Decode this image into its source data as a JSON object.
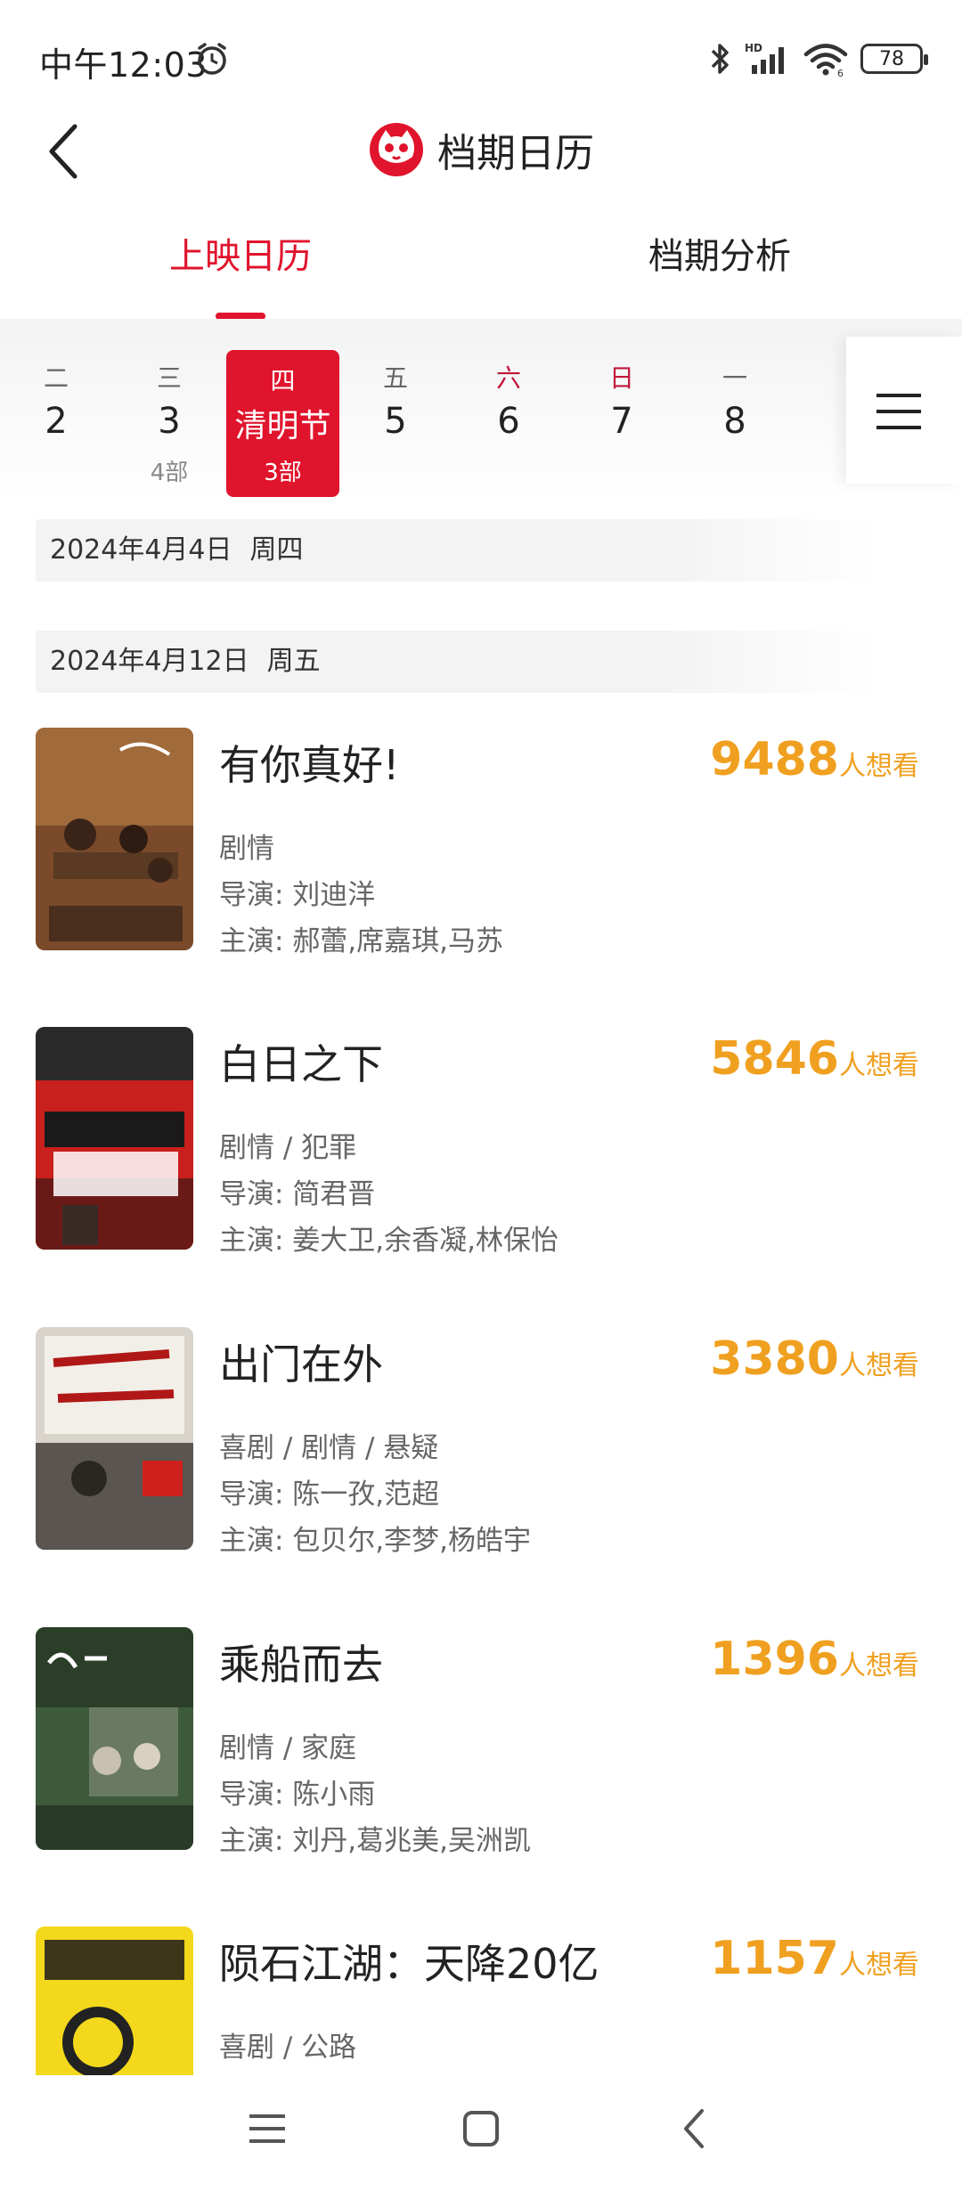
{
  "status_bar": {
    "time": "中午12:03",
    "battery": "78"
  },
  "header": {
    "title": "档期日历"
  },
  "tabs": [
    {
      "label": "上映日历",
      "active": true
    },
    {
      "label": "档期分析",
      "active": false
    }
  ],
  "date_strip": {
    "days": [
      {
        "weekday": "二",
        "day": "2",
        "count": "",
        "weekend": false
      },
      {
        "weekday": "三",
        "day": "3",
        "count": "4部",
        "weekend": false
      },
      {
        "weekday": "四",
        "day": "清明节",
        "count": "3部",
        "weekend": false,
        "selected": true
      },
      {
        "weekday": "五",
        "day": "5",
        "count": "",
        "weekend": false
      },
      {
        "weekday": "六",
        "day": "6",
        "count": "",
        "weekend": true
      },
      {
        "weekday": "日",
        "day": "7",
        "count": "",
        "weekend": true
      },
      {
        "weekday": "一",
        "day": "8",
        "count": "",
        "weekend": false
      }
    ]
  },
  "sections": [
    {
      "date": "2024年4月4日",
      "weekday": "周四"
    },
    {
      "date": "2024年4月12日",
      "weekday": "周五"
    }
  ],
  "movies": [
    {
      "title": "有你真好!",
      "want_count": "9488",
      "want_label": "人想看",
      "genre": "剧情",
      "director": "导演: 刘迪洋",
      "cast": "主演: 郝蕾,席嘉琪,马苏",
      "poster_color": "#7a4a2a"
    },
    {
      "title": "白日之下",
      "want_count": "5846",
      "want_label": "人想看",
      "genre": "剧情 / 犯罪",
      "director": "导演: 简君晋",
      "cast": "主演: 姜大卫,余香凝,林保怡",
      "poster_color": "#c8201c"
    },
    {
      "title": "出门在外",
      "want_count": "3380",
      "want_label": "人想看",
      "genre": "喜剧 / 剧情 / 悬疑",
      "director": "导演: 陈一孜,范超",
      "cast": "主演: 包贝尔,李梦,杨皓宇",
      "poster_color": "#8a8a8a"
    },
    {
      "title": "乘船而去",
      "want_count": "1396",
      "want_label": "人想看",
      "genre": "剧情 / 家庭",
      "director": "导演: 陈小雨",
      "cast": "主演: 刘丹,葛兆美,吴洲凯",
      "poster_color": "#3d5a3a"
    },
    {
      "title": "陨石江湖：天降20亿",
      "want_count": "1157",
      "want_label": "人想看",
      "genre": "喜剧 / 公路",
      "director": "",
      "cast": "",
      "poster_color": "#f3d81c"
    }
  ],
  "colors": {
    "accent": "#e0142c",
    "want": "#f0a020"
  },
  "icons": {
    "back": "back-arrow-icon",
    "menu": "hamburger-menu-icon",
    "logo": "cat-eye-logo-icon"
  }
}
